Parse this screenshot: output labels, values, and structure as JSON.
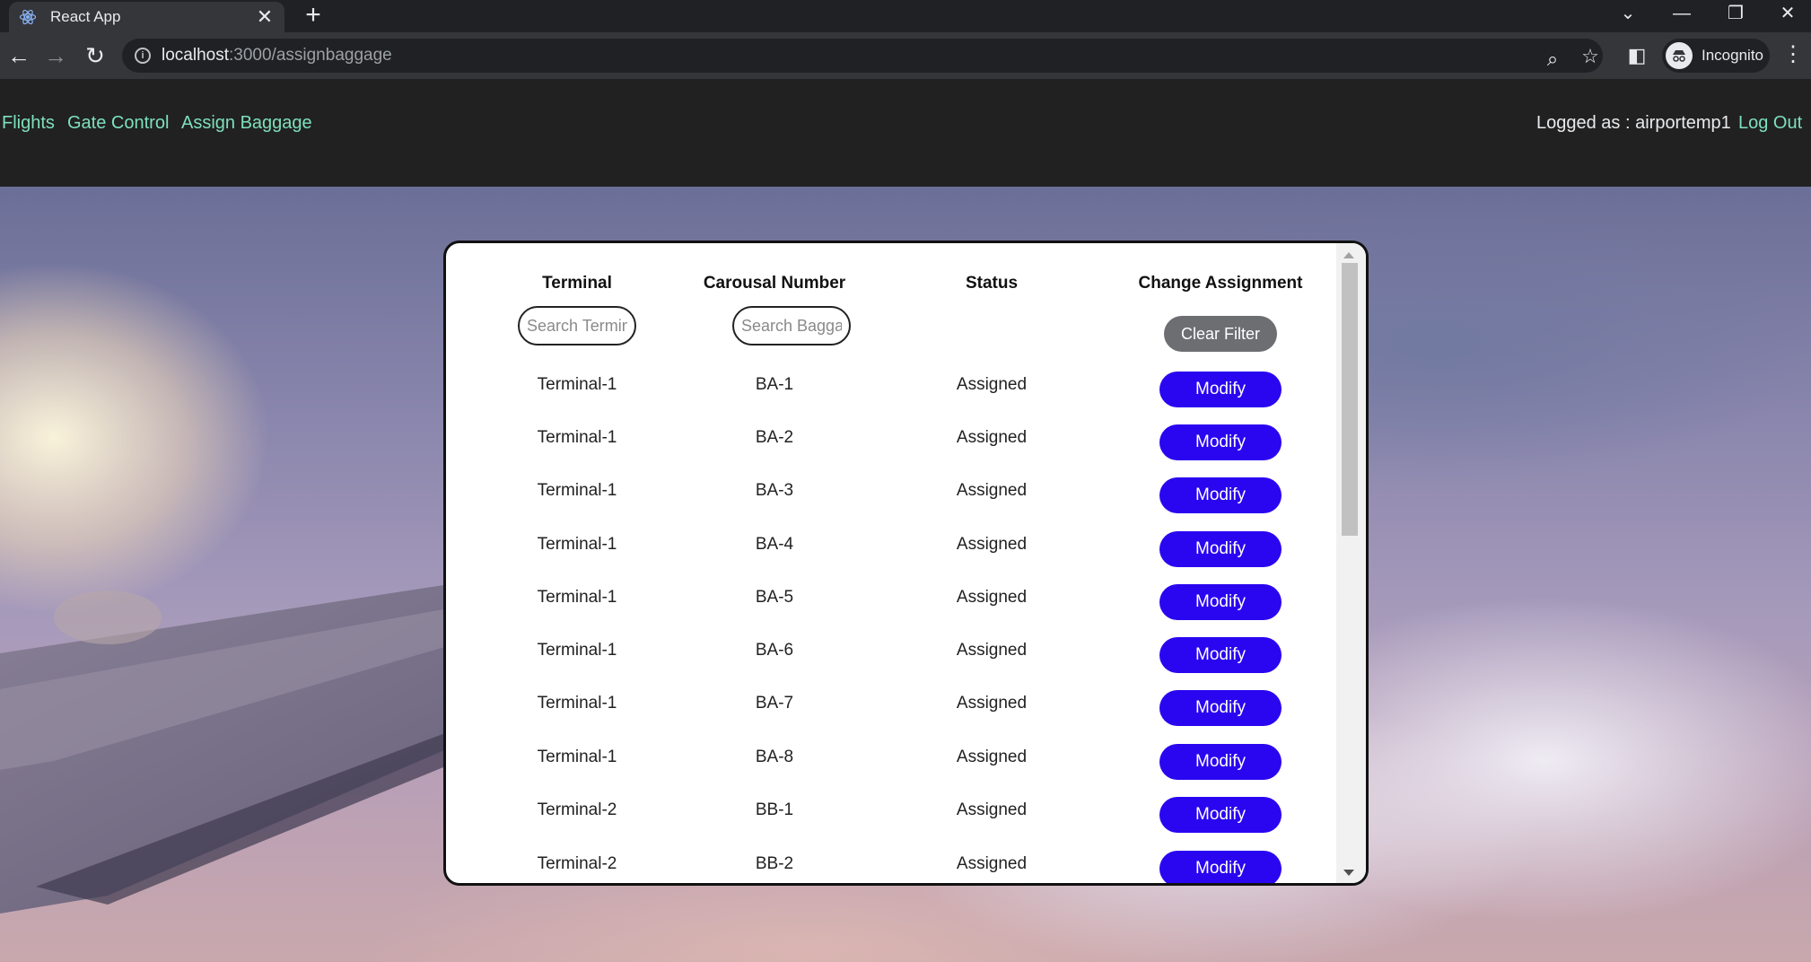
{
  "browser": {
    "tab_title": "React App",
    "url_host": "localhost",
    "url_path": ":3000/assignbaggage",
    "profile_label": "Incognito"
  },
  "nav": {
    "links": [
      "Flights",
      "Gate Control",
      "Assign Baggage"
    ],
    "logged_as": "Logged as : airportemp1",
    "logout": "Log Out"
  },
  "table": {
    "headers": [
      "Terminal",
      "Carousal Number",
      "Status",
      "Change Assignment"
    ],
    "terminal_search_placeholder": "Search Terminal",
    "baggage_search_placeholder": "Search Baggage",
    "clear_filter": "Clear Filter",
    "action_label": "Modify",
    "rows": [
      {
        "terminal": "Terminal-1",
        "carousel": "BA-1",
        "status": "Assigned"
      },
      {
        "terminal": "Terminal-1",
        "carousel": "BA-2",
        "status": "Assigned"
      },
      {
        "terminal": "Terminal-1",
        "carousel": "BA-3",
        "status": "Assigned"
      },
      {
        "terminal": "Terminal-1",
        "carousel": "BA-4",
        "status": "Assigned"
      },
      {
        "terminal": "Terminal-1",
        "carousel": "BA-5",
        "status": "Assigned"
      },
      {
        "terminal": "Terminal-1",
        "carousel": "BA-6",
        "status": "Assigned"
      },
      {
        "terminal": "Terminal-1",
        "carousel": "BA-7",
        "status": "Assigned"
      },
      {
        "terminal": "Terminal-1",
        "carousel": "BA-8",
        "status": "Assigned"
      },
      {
        "terminal": "Terminal-2",
        "carousel": "BB-1",
        "status": "Assigned"
      },
      {
        "terminal": "Terminal-2",
        "carousel": "BB-2",
        "status": "Assigned"
      }
    ]
  },
  "colors": {
    "nav_link": "#7ee0bd",
    "modify_button": "#2a06f0",
    "clear_button": "#6c6e72"
  }
}
